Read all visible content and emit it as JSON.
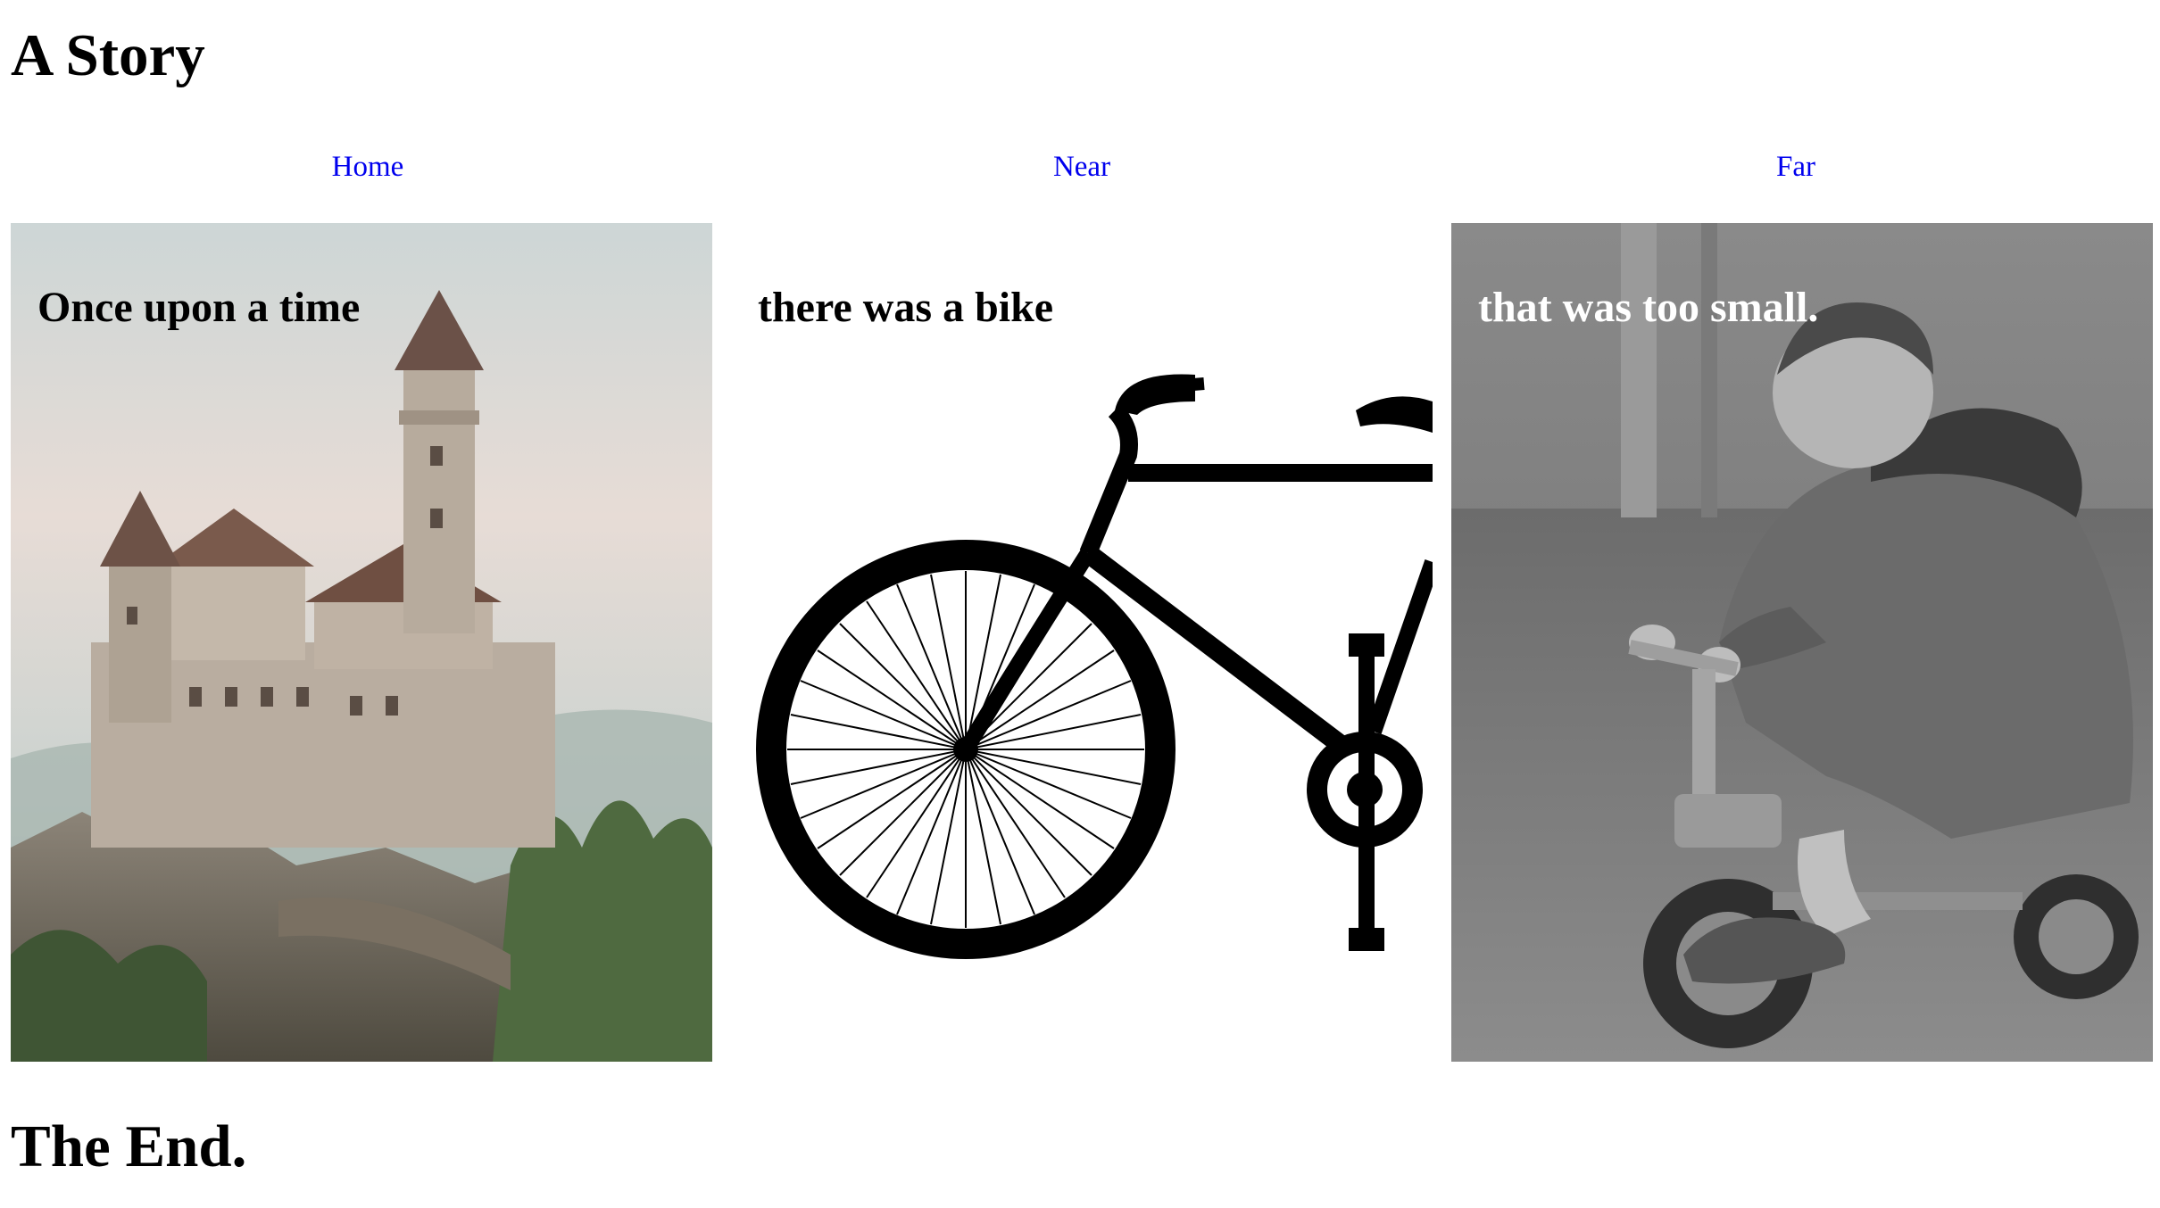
{
  "header": {
    "title": "A Story"
  },
  "nav": {
    "items": [
      {
        "label": "Home"
      },
      {
        "label": "Near"
      },
      {
        "label": "Far"
      }
    ]
  },
  "panels": [
    {
      "caption": "Once upon a time",
      "image": "castle-illustration"
    },
    {
      "caption": "there was a bike",
      "image": "bicycle-silhouette"
    },
    {
      "caption": "that was too small.",
      "image": "child-on-tricycle-photo"
    }
  ],
  "footer": {
    "title": "The End."
  },
  "colors": {
    "link": "#0000ee",
    "text": "#000000",
    "caption_light": "#ffffff"
  }
}
